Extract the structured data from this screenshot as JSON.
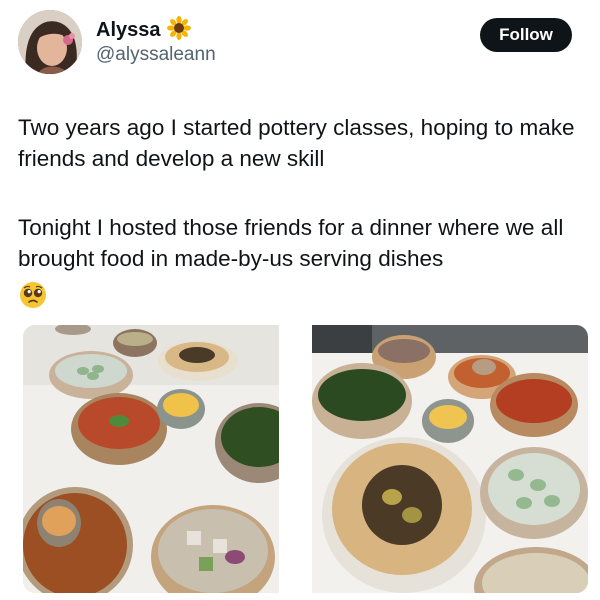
{
  "user": {
    "display_name": "Alyssa",
    "handle": "@alyssaleann",
    "name_badge_icon": "sunflower-icon"
  },
  "follow_button": {
    "label": "Follow"
  },
  "tweet": {
    "paragraph_1": "Two years ago I started pottery classes, hoping to make friends and develop a new skill",
    "paragraph_2": "Tonight I hosted those friends for a dinner where we all brought food in made-by-us serving dishes",
    "emoji": "pleading-face-icon"
  },
  "colors": {
    "follow_bg": "#0f1419",
    "text_primary": "#0f1419",
    "text_secondary": "#536471"
  }
}
